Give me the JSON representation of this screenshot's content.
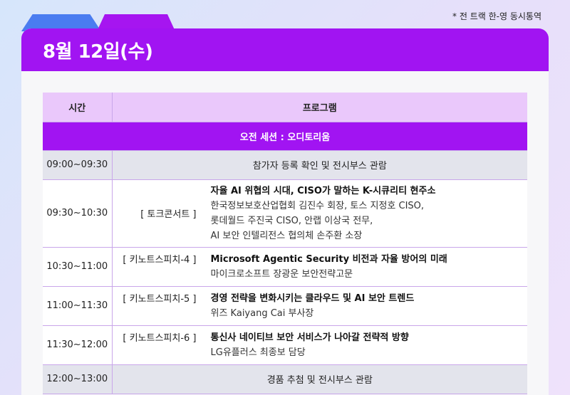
{
  "note": "* 전 트랙 한-영 동시통역",
  "date_title": "8월 12일(수)",
  "colors": {
    "accent": "#a114f2",
    "tab_blue": "#4a7cf0",
    "header_row": "#eac8fb",
    "gray_row": "#e3e4ec"
  },
  "table": {
    "headers": {
      "time": "시간",
      "program": "프로그램"
    },
    "session": "오전 세션 : 오디토리움",
    "rows": [
      {
        "time": "09:00~09:30",
        "text": "참가자 등록 확인 및 전시부스 관람"
      },
      {
        "time": "09:30~10:30",
        "tag": "[ 토크콘서트 ]",
        "title": "자율 AI 위협의 시대, CISO가 말하는 K-시큐리티 현주소",
        "lines": [
          "한국정보보호산업협회 김진수 회장, 토스 지정호 CISO,",
          "롯데월드 주진국 CISO, 안랩 이상국 전무,",
          "AI 보안 인텔리전스 협의체 손주환 소장"
        ]
      },
      {
        "time": "10:30~11:00",
        "tag": "[ 키노트스피치-4 ]",
        "title": "Microsoft Agentic Security 비전과 자율 방어의 미래",
        "lines": [
          "마이크로소프트 장광운 보안전략고문"
        ]
      },
      {
        "time": "11:00~11:30",
        "tag": "[ 키노트스피치-5 ]",
        "title": "경영 전략을 변화시키는 클라우드 및 AI 보안 트렌드",
        "lines": [
          "위즈 Kaiyang Cai 부사장"
        ]
      },
      {
        "time": "11:30~12:00",
        "tag": "[ 키노트스피치-6 ]",
        "title": "통신사 네이티브 보안 서비스가 나아갈 전략적 방향",
        "lines": [
          "LG유플러스 최종보 담당"
        ]
      },
      {
        "time": "12:00~13:00",
        "text": "경품 추첨 및 전시부스 관람"
      }
    ]
  }
}
